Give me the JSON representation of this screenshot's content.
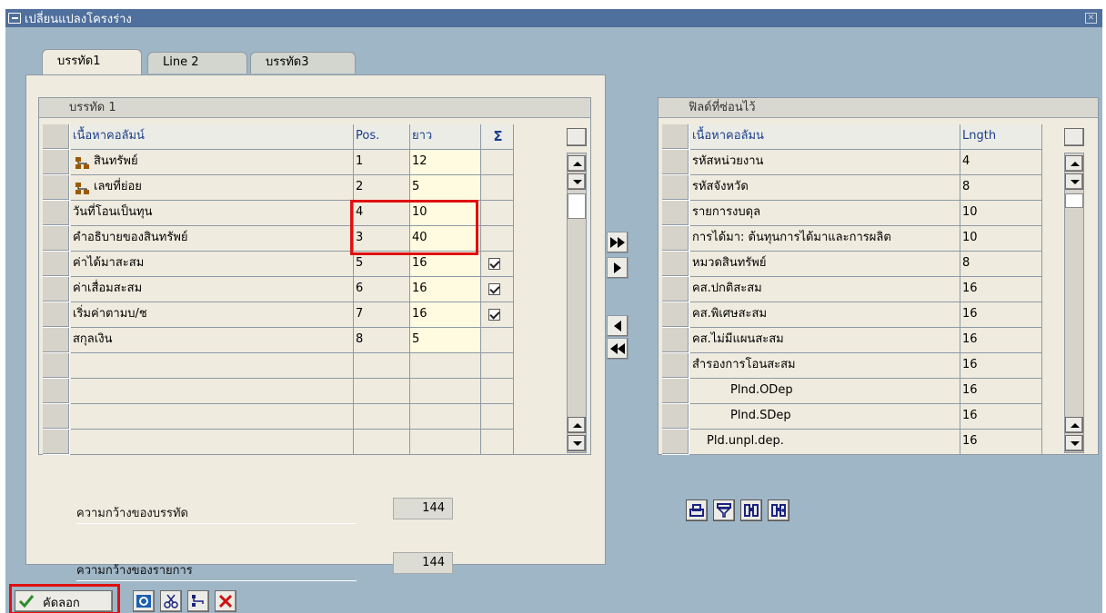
{
  "window": {
    "title": "เปลี่ยนแปลงโครงร่าง"
  },
  "tabs": [
    {
      "label": "บรรทัด1",
      "active": true
    },
    {
      "label": "Line 2",
      "active": false
    },
    {
      "label": "บรรทัด3",
      "active": false
    }
  ],
  "left_group": {
    "title": "บรรทัด 1",
    "headers": {
      "content": "เนื้อหาคอลัมน์",
      "pos": "Pos.",
      "len": "ยาว",
      "sum": "Σ"
    },
    "rows": [
      {
        "content": "สินทรัพย์",
        "icon": "hierarchy-icon",
        "pos": "1",
        "len": "12",
        "checked": false
      },
      {
        "content": "เลขที่ย่อย",
        "icon": "hierarchy-icon",
        "pos": "2",
        "len": "5",
        "checked": false
      },
      {
        "content": "วันที่โอนเป็นทุน",
        "pos": "4",
        "len": "10",
        "checked": false
      },
      {
        "content": "คำอธิบายของสินทรัพย์",
        "pos": "3",
        "len": "40",
        "checked": false
      },
      {
        "content": "ค่าได้มาสะสม",
        "pos": "5",
        "len": "16",
        "checked": true
      },
      {
        "content": "ค่าเสื่อมสะสม",
        "pos": "6",
        "len": "16",
        "checked": true
      },
      {
        "content": "เริ่มค่าตามบ/ช",
        "pos": "7",
        "len": "16",
        "checked": true
      },
      {
        "content": "สกุลเงิน",
        "pos": "8",
        "len": "5",
        "checked": false
      },
      {
        "content": "",
        "pos": "",
        "len": "",
        "checked": false
      },
      {
        "content": "",
        "pos": "",
        "len": "",
        "checked": false
      },
      {
        "content": "",
        "pos": "",
        "len": "",
        "checked": false
      },
      {
        "content": "",
        "pos": "",
        "len": "",
        "checked": false
      }
    ]
  },
  "line_width": {
    "label": "ความกว้างของบรรทัด",
    "value": "144"
  },
  "list_width": {
    "label": "ความกว้างของรายการ",
    "value": "144"
  },
  "right_group": {
    "title": "ฟิลด์ที่ซ่อนไว้",
    "headers": {
      "content": "เนื้อหาคอลัมน",
      "len": "Lngth"
    },
    "rows": [
      {
        "content": "รหัสหน่วยงาน",
        "len": "4"
      },
      {
        "content": "รหัสจังหวัด",
        "len": "8"
      },
      {
        "content": "รายการงบดุล",
        "len": "10"
      },
      {
        "content": "การได้มา: ต้นทุนการได้มาและการผลิต",
        "len": "10"
      },
      {
        "content": "หมวดสินทรัพย์",
        "len": "8"
      },
      {
        "content": "คส.ปกติสะสม",
        "len": "16"
      },
      {
        "content": "คส.พิเศษสะสม",
        "len": "16"
      },
      {
        "content": "คส.ไม่มีแผนสะสม",
        "len": "16"
      },
      {
        "content": "สำรองการโอนสะสม",
        "len": "16"
      },
      {
        "content": "Plnd.ODep",
        "len": "16",
        "indent": 2
      },
      {
        "content": "Plnd.SDep",
        "len": "16",
        "indent": 2
      },
      {
        "content": "Pld.unpl.dep.",
        "len": "16",
        "indent": 1
      }
    ]
  },
  "bottom": {
    "copy_label": "คัดลอก"
  },
  "colors": {
    "highlight": "#e01010",
    "title_bg": "#4f6f9c",
    "window_bg": "#9fb6c7",
    "panel_bg": "#efebde"
  }
}
